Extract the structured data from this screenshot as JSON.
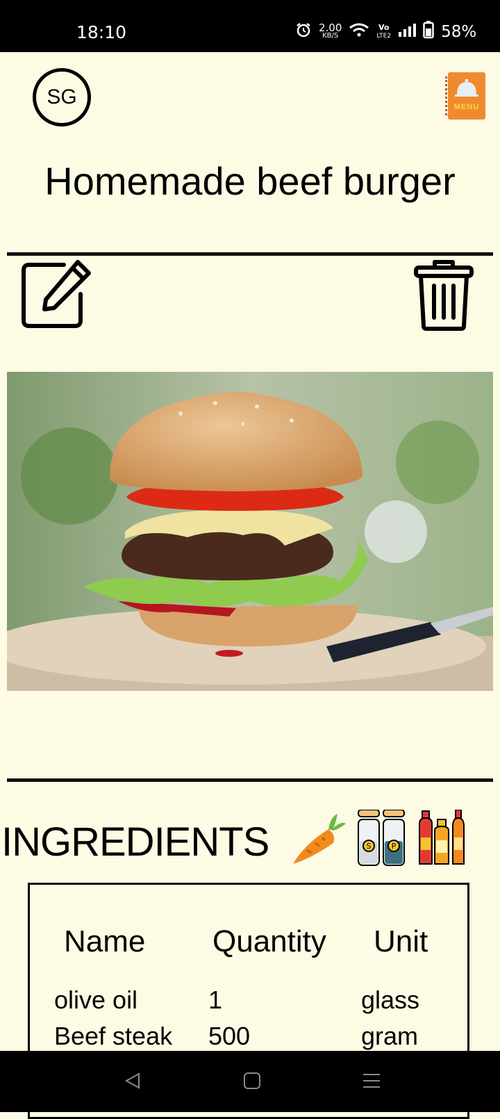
{
  "status_bar": {
    "time": "18:10",
    "net_speed_value": "2.00",
    "net_speed_unit": "KB/S",
    "lte_top": "Vo",
    "lte_bottom": "LTE2",
    "battery": "58%",
    "icons": [
      "alarm-icon",
      "wifi-icon",
      "volte-icon",
      "signal-icon",
      "battery-icon"
    ]
  },
  "header": {
    "avatar_initials": "SG",
    "menu_label": "MENU",
    "accent_color": "#f08a2e"
  },
  "recipe": {
    "title": "Homemade beef burger",
    "image_subject": "beef burger with tomato, cheese and lettuce on wooden board"
  },
  "ingredients": {
    "heading": "INGREDIENTS",
    "heading_icons": [
      "carrot-icon",
      "salt-pepper-icon",
      "sauce-bottles-icon"
    ],
    "columns": [
      "Name",
      "Quantity",
      "Unit"
    ],
    "rows": [
      {
        "name": "olive oil",
        "quantity": "1",
        "unit": "glass"
      },
      {
        "name": "Beef steak",
        "quantity": "500",
        "unit": "gram"
      }
    ]
  },
  "colors": {
    "background": "#fdfbe4",
    "ink": "#000000"
  }
}
